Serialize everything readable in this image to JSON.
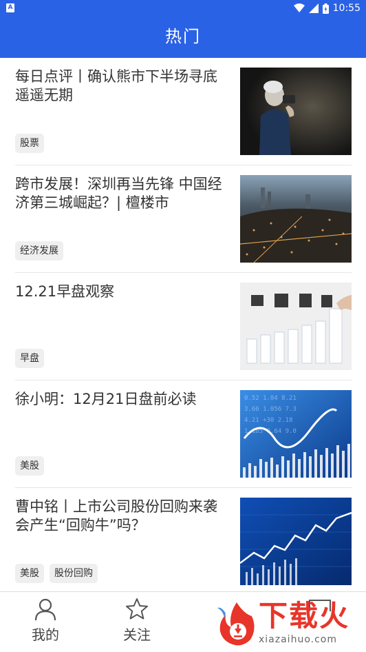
{
  "status_bar": {
    "time": "10:55",
    "sim_label": "A"
  },
  "header": {
    "title": "热门"
  },
  "articles": [
    {
      "title": "每日点评丨确认熊市下半场寻底遥遥无期",
      "tags": [
        "股票"
      ],
      "image": "man-with-camera"
    },
    {
      "title": "跨市发展！深圳再当先锋  中国经济第三城崛起？| 檀楼市",
      "tags": [
        "经济发展"
      ],
      "image": "city-night-skyline"
    },
    {
      "title": "12.21早盘观察",
      "tags": [
        "早盘"
      ],
      "image": "strategy-bar-chart"
    },
    {
      "title": "徐小明：12月21日盘前必读",
      "tags": [
        "美股"
      ],
      "image": "stock-ticker-board"
    },
    {
      "title": "曹中铭丨上市公司股份回购来袭会产生“回购牛”吗？",
      "tags": [
        "美股",
        "股份回购"
      ],
      "image": "stock-line-chart"
    }
  ],
  "bottom_nav": {
    "items": [
      {
        "label": "我的",
        "icon": "person-icon"
      },
      {
        "label": "关注",
        "icon": "star-icon"
      }
    ]
  },
  "watermark": {
    "text": "下载火",
    "url": "xiazaihuo.com"
  }
}
